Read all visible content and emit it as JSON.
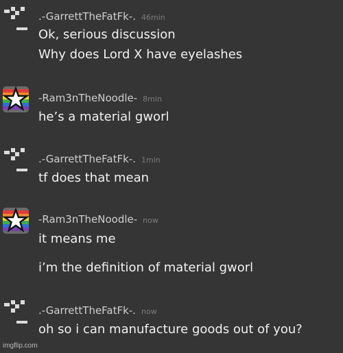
{
  "messages": [
    {
      "user": ".-GarrettTheFatFk-.",
      "avatar": "pixel-glyph-icon",
      "time": "46min",
      "lines": [
        "Ok, serious discussion",
        "Why does Lord X have eyelashes"
      ]
    },
    {
      "user": "-Ram3nTheNoodle-",
      "avatar": "rainbow-star-icon",
      "time": "8min",
      "lines": [
        "he’s a material gworl"
      ]
    },
    {
      "user": ".-GarrettTheFatFk-.",
      "avatar": "pixel-glyph-icon",
      "time": "1min",
      "lines": [
        "tf does that mean"
      ]
    },
    {
      "user": "-Ram3nTheNoodle-",
      "avatar": "rainbow-star-icon",
      "time": "now",
      "lines": [
        "it means me",
        "i’m the definition of material gworl"
      ]
    },
    {
      "user": ".-GarrettTheFatFk-.",
      "avatar": "pixel-glyph-icon",
      "time": "now",
      "lines": [
        "oh so i can manufacture goods out of you?"
      ]
    }
  ],
  "watermark": "imgflip.com",
  "colors": {
    "background": "#353535",
    "username": "#cfcfcf",
    "timestamp": "#7d7d7d",
    "message_text": "#f1f1f1"
  }
}
